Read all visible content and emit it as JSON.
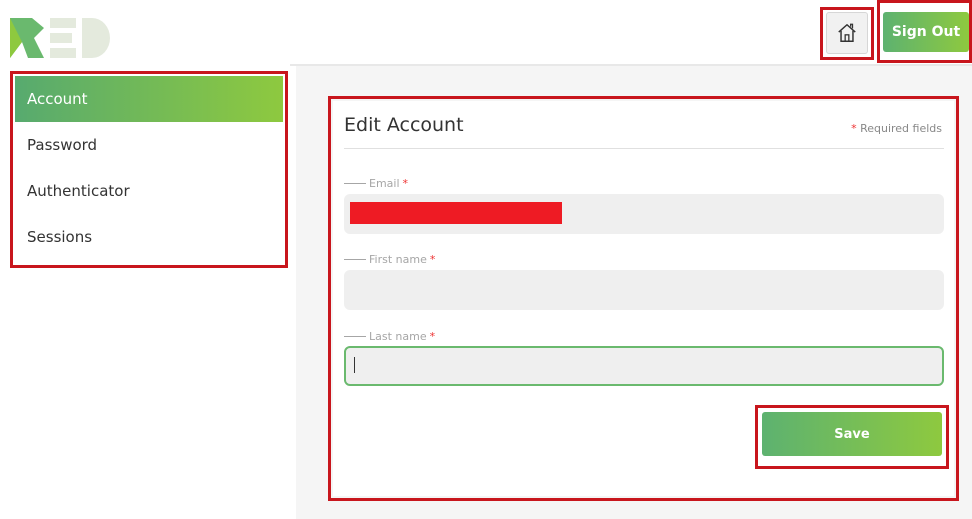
{
  "brand": {
    "logo_text": "RED"
  },
  "header": {
    "home_icon": "house-icon",
    "sign_out_label": "Sign Out"
  },
  "sidebar": {
    "items": [
      {
        "label": "Account",
        "active": true
      },
      {
        "label": "Password",
        "active": false
      },
      {
        "label": "Authenticator",
        "active": false
      },
      {
        "label": "Sessions",
        "active": false
      }
    ]
  },
  "form": {
    "title": "Edit Account",
    "required_note": "Required fields",
    "required_marker": "*",
    "fields": [
      {
        "label": "Email",
        "value": "",
        "redacted": true
      },
      {
        "label": "First name",
        "value": ""
      },
      {
        "label": "Last name",
        "value": "",
        "focused": true
      }
    ],
    "save_label": "Save"
  },
  "colors": {
    "accent_start": "#5db270",
    "accent_end": "#8ec93f",
    "annotation_red": "#c8161d",
    "redaction_red": "#ee1b24",
    "required_star": "#e33333"
  }
}
